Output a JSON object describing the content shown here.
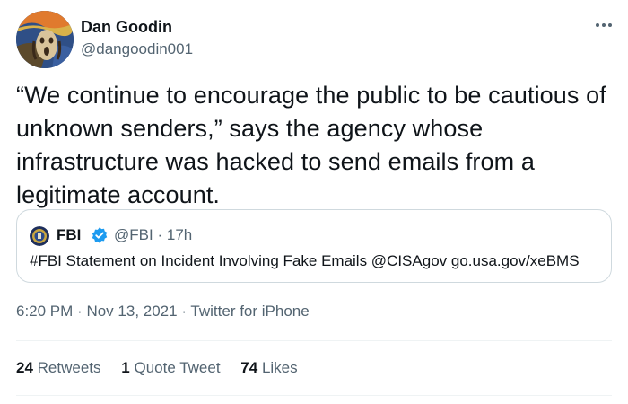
{
  "author": {
    "display_name": "Dan Goodin",
    "handle": "@dangoodin001",
    "avatar_icon": "scream-painting-avatar"
  },
  "more_icon": "more-horizontal-icon",
  "tweet_text": "“We continue to encourage the public to be cautious of unknown senders,” says the agency whose infrastructure was hacked to send emails from a legitimate account.",
  "quoted_tweet": {
    "display_name": "FBI",
    "verified": true,
    "handle": "@FBI",
    "separator": "·",
    "time_ago": "17h",
    "text": "#FBI Statement on Incident Involving Fake Emails @CISAgov go.usa.gov/xeBMS"
  },
  "timestamp": {
    "time": "6:20 PM",
    "sep1": "·",
    "date": "Nov 13, 2021",
    "sep2": "·",
    "source": "Twitter for iPhone"
  },
  "stats": {
    "retweets_count": "24",
    "retweets_label": "Retweets",
    "quotes_count": "1",
    "quotes_label": "Quote Tweet",
    "likes_count": "74",
    "likes_label": "Likes"
  },
  "colors": {
    "text_primary": "#0f1419",
    "text_secondary": "#536471",
    "verified_blue": "#1d9bf0",
    "border": "#cfd9de"
  }
}
